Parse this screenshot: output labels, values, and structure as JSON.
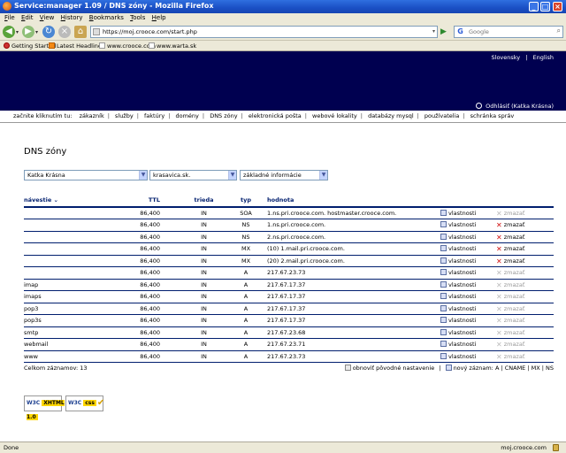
{
  "window": {
    "title": "Service:manager 1.09 / DNS zóny - Mozilla Firefox",
    "min": "_",
    "max": "□",
    "close": "×"
  },
  "menu": [
    "File",
    "Edit",
    "View",
    "History",
    "Bookmarks",
    "Tools",
    "Help"
  ],
  "nav": {
    "url": "https://moj.crooce.com/start.php",
    "search_placeholder": "Google",
    "google_glyph": "G"
  },
  "bookmarks": [
    "Getting Started",
    "Latest Headlines",
    "www.crooce.com",
    "www.warta.sk"
  ],
  "banner": {
    "lang1": "Slovensky",
    "lang_sep": "|",
    "lang2": "English",
    "logout": "Odhlásiť (Katka Krásna)"
  },
  "mainnav": {
    "start": "začnite kliknutím tu:",
    "items": [
      "zákazník",
      "služby",
      "faktúry",
      "domény",
      "DNS zóny",
      "elektronická pošta",
      "webové lokality",
      "databázy mysql",
      "používatelia",
      "schránka správ"
    ]
  },
  "page": {
    "title": "DNS zóny",
    "select_user": "Katka Krásna",
    "select_domain": "krasavica.sk.",
    "select_view": "základné informácie"
  },
  "table": {
    "headers": {
      "name": "návestie ⌄",
      "ttl": "TTL",
      "class": "trieda",
      "type": "typ",
      "value": "hodnota"
    },
    "prop_label": "vlastnosti",
    "del_label": "zmazať",
    "rows": [
      {
        "name": "",
        "ttl": "86,400",
        "class": "IN",
        "type": "SOA",
        "value": "1.ns.pri.crooce.com. hostmaster.crooce.com.",
        "del_disabled": true
      },
      {
        "name": "",
        "ttl": "86,400",
        "class": "IN",
        "type": "NS",
        "value": "1.ns.pri.crooce.com.",
        "del_disabled": false
      },
      {
        "name": "",
        "ttl": "86,400",
        "class": "IN",
        "type": "NS",
        "value": "2.ns.pri.crooce.com.",
        "del_disabled": false
      },
      {
        "name": "",
        "ttl": "86,400",
        "class": "IN",
        "type": "MX",
        "value": "(10) 1.mail.pri.crooce.com.",
        "del_disabled": false
      },
      {
        "name": "",
        "ttl": "86,400",
        "class": "IN",
        "type": "MX",
        "value": "(20) 2.mail.pri.crooce.com.",
        "del_disabled": false
      },
      {
        "name": "",
        "ttl": "86,400",
        "class": "IN",
        "type": "A",
        "value": "217.67.23.73",
        "del_disabled": true
      },
      {
        "name": "imap",
        "ttl": "86,400",
        "class": "IN",
        "type": "A",
        "value": "217.67.17.37",
        "del_disabled": true
      },
      {
        "name": "imaps",
        "ttl": "86,400",
        "class": "IN",
        "type": "A",
        "value": "217.67.17.37",
        "del_disabled": true
      },
      {
        "name": "pop3",
        "ttl": "86,400",
        "class": "IN",
        "type": "A",
        "value": "217.67.17.37",
        "del_disabled": true
      },
      {
        "name": "pop3s",
        "ttl": "86,400",
        "class": "IN",
        "type": "A",
        "value": "217.67.17.37",
        "del_disabled": true
      },
      {
        "name": "smtp",
        "ttl": "86,400",
        "class": "IN",
        "type": "A",
        "value": "217.67.23.68",
        "del_disabled": true
      },
      {
        "name": "webmail",
        "ttl": "86,400",
        "class": "IN",
        "type": "A",
        "value": "217.67.23.71",
        "del_disabled": true
      },
      {
        "name": "www",
        "ttl": "86,400",
        "class": "IN",
        "type": "A",
        "value": "217.67.23.73",
        "del_disabled": true
      }
    ]
  },
  "footer": {
    "count": "Celkom záznamov: 13",
    "reset": "obnoviť pôvodné nastavenie",
    "sep": "|",
    "new_record": "nový záznam:",
    "new_types": [
      "A",
      "CNAME",
      "MX",
      "NS"
    ]
  },
  "badges": {
    "xhtml_w3c": "W3C",
    "xhtml_label": "XHTML 1.0",
    "css_w3c": "W3C",
    "css_label": "css"
  },
  "status": {
    "left": "Done",
    "right": "moj.crooce.com"
  }
}
